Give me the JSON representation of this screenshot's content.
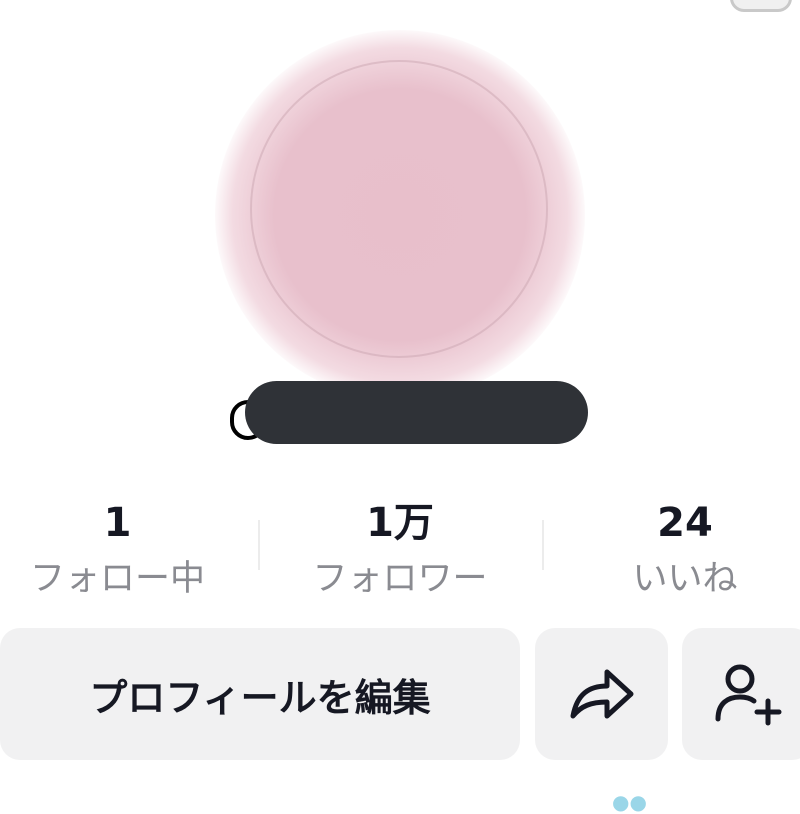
{
  "profile": {
    "handle_prefix": "@",
    "handle_redacted": true
  },
  "stats": [
    {
      "value": "1",
      "label": "フォロー中"
    },
    {
      "value": "1万",
      "label": "フォロワー"
    },
    {
      "value": "24",
      "label": "いいね"
    }
  ],
  "actions": {
    "edit_profile_label": "プロフィールを編集",
    "share_icon": "share-arrow-icon",
    "add_friend_icon": "add-user-icon"
  },
  "colors": {
    "avatar_pink": "#e8c0cc",
    "redaction": "#2f3237",
    "button_bg": "#f1f1f2",
    "stat_label": "#8a8b91"
  }
}
